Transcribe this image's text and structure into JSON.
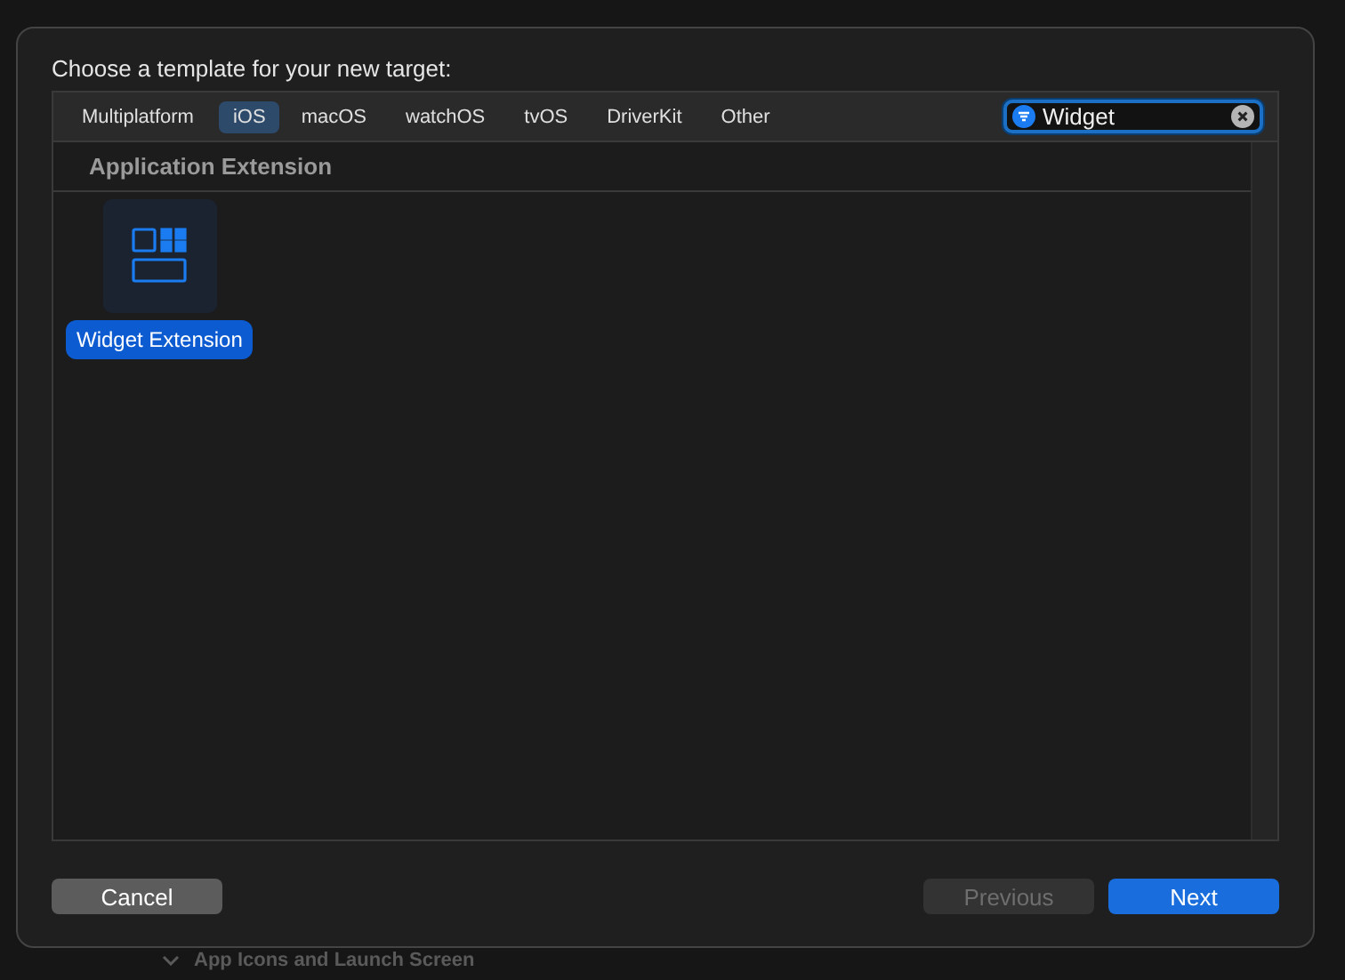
{
  "dialog": {
    "title": "Choose a template for your new target:",
    "tabs": [
      {
        "label": "Multiplatform",
        "selected": false
      },
      {
        "label": "iOS",
        "selected": true
      },
      {
        "label": "macOS",
        "selected": false
      },
      {
        "label": "watchOS",
        "selected": false
      },
      {
        "label": "tvOS",
        "selected": false
      },
      {
        "label": "DriverKit",
        "selected": false
      },
      {
        "label": "Other",
        "selected": false
      }
    ],
    "search": {
      "value": "Widget"
    },
    "sections": [
      {
        "title": "Application Extension",
        "templates": [
          {
            "label": "Widget Extension",
            "selected": true
          }
        ]
      }
    ],
    "buttons": [
      {
        "label": "Cancel",
        "kind": "secondary",
        "disabled": false
      },
      {
        "label": "Previous",
        "kind": "secondary",
        "disabled": true
      },
      {
        "label": "Next",
        "kind": "primary",
        "disabled": false
      }
    ]
  },
  "background": {
    "section": "App Icons and Launch Screen"
  }
}
